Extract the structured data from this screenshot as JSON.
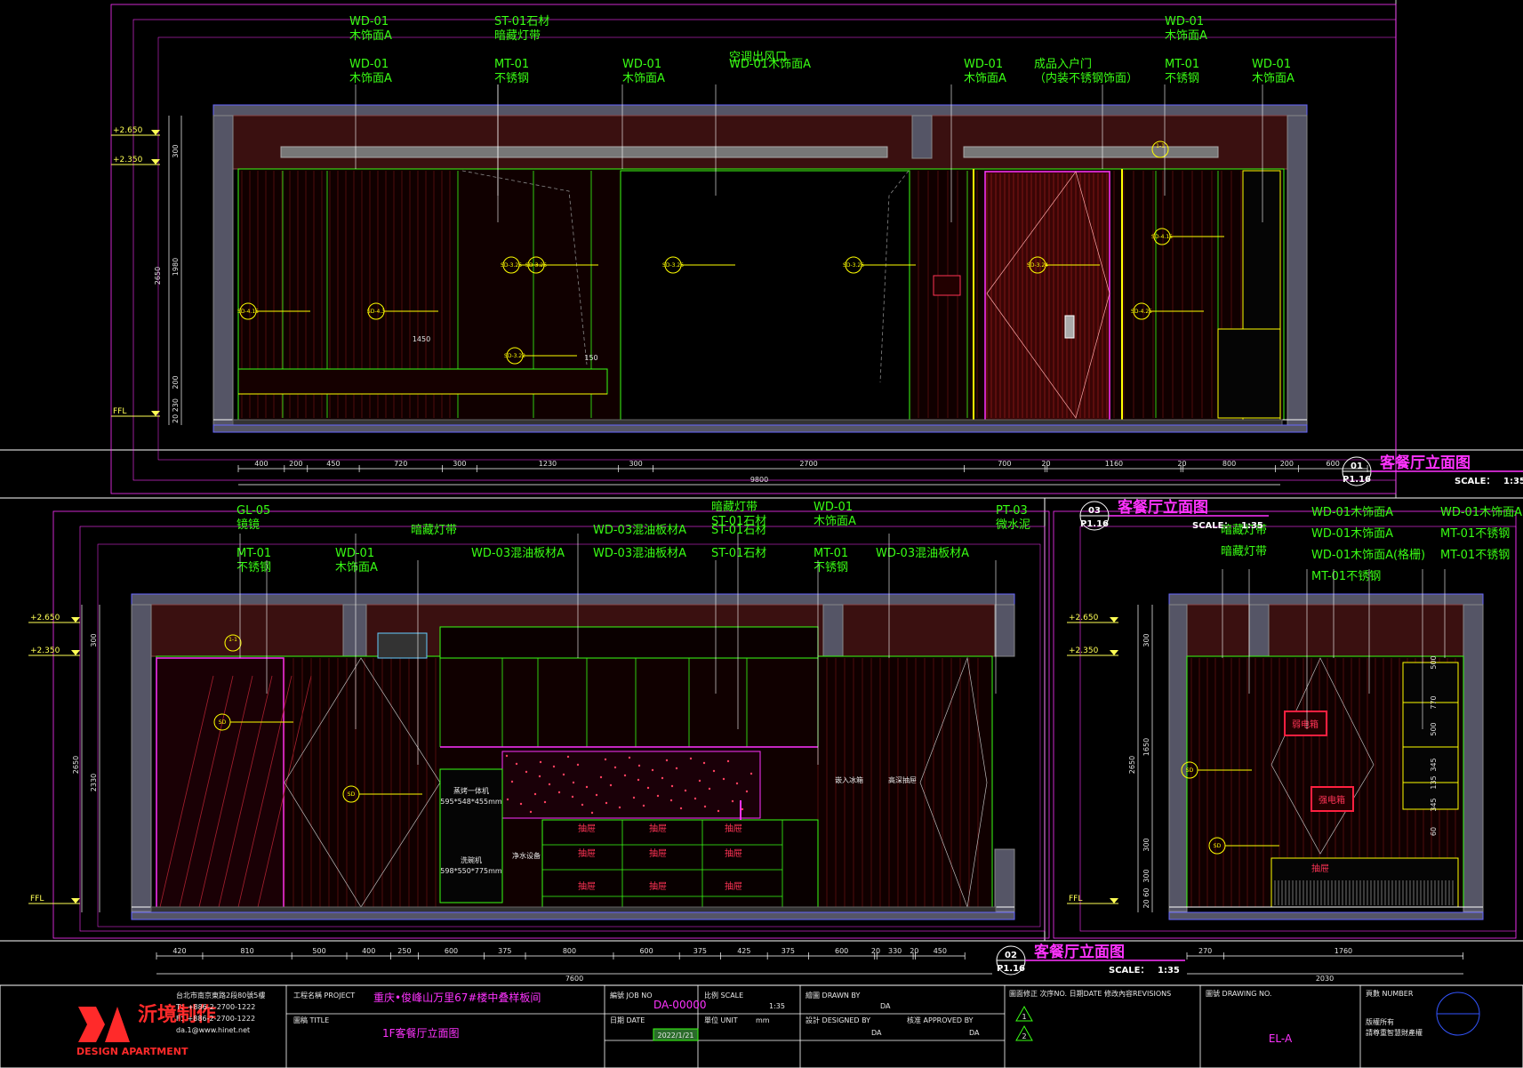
{
  "colors": {
    "bg": "#000000",
    "frame": "#ff33ff",
    "green": "#39ff14",
    "wall": "#555566",
    "ceiling": "#3a1010",
    "dim": "#ffffff",
    "leader": "#ffffff",
    "red": "#cc1030"
  },
  "elev1": {
    "labels": [
      {
        "code": "WD-01",
        "name": "木饰面A"
      },
      {
        "code": "ST-01石材",
        "name": "暗藏灯带"
      },
      {
        "code": "",
        "name": "空调出风口"
      },
      {
        "code": "WD-01",
        "name": "木饰面A"
      },
      {
        "code": "WD-01",
        "name": "木饰面A"
      },
      {
        "code": "MT-01",
        "name": "不锈钢"
      },
      {
        "code": "WD-01",
        "name": "木饰面A"
      },
      {
        "code": "WD-01木饰面A",
        "name": ""
      },
      {
        "code": "WD-01",
        "name": "木饰面A"
      },
      {
        "code": "成品入户门",
        "name": "（内装不锈钢饰面）"
      },
      {
        "code": "MT-01",
        "name": "不锈钢"
      },
      {
        "code": "WD-01",
        "name": "木饰面A"
      }
    ],
    "levels": [
      "+2.650",
      "+2.350",
      "FFL"
    ],
    "vdims": [
      "300",
      "1980",
      "2650",
      "200",
      "20 230"
    ],
    "hdims": [
      "400",
      "200",
      "450",
      "720",
      "300",
      "1230",
      "300",
      "2700",
      "700",
      "20",
      "1160",
      "20",
      "800",
      "200",
      "600"
    ],
    "total": "9800",
    "inner": [
      "1450",
      "150"
    ],
    "title": "客餐厅立面图",
    "num": "01",
    "sheet": "P1.16",
    "scale_label": "SCALE：",
    "scale": "1:35",
    "tags": [
      "SD-4.15",
      "SD-4.3",
      "SD-3.26",
      "SD-3.26",
      "SD-3.26",
      "SD-3.26",
      "SD-3.22",
      "SD-3.24",
      "SD-4.15",
      "SD-4.25"
    ],
    "callout": "1-1"
  },
  "elev2": {
    "labels": [
      {
        "code": "GL-05",
        "name": "镜镜"
      },
      {
        "code": "MT-01",
        "name": "不锈钢"
      },
      {
        "code": "WD-01",
        "name": "木饰面A"
      },
      {
        "code": "暗藏灯带",
        "name": ""
      },
      {
        "code": "WD-03混油板材A",
        "name": ""
      },
      {
        "code": "WD-03混油板材A",
        "name": ""
      },
      {
        "code": "WD-03混油板材A",
        "name": ""
      },
      {
        "code": "暗藏灯带",
        "name": "ST-01石材"
      },
      {
        "code": "ST-01石材",
        "name": ""
      },
      {
        "code": "WD-01",
        "name": "木饰面A"
      },
      {
        "code": "MT-01",
        "name": "不锈钢"
      },
      {
        "code": "WD-03混油板材A",
        "name": ""
      },
      {
        "code": "PT-03",
        "name": "微水泥"
      }
    ],
    "levels": [
      "+2.650",
      "+2.350",
      "FFL"
    ],
    "vdims": [
      "300",
      "2330",
      "2650"
    ],
    "hdims": [
      "420",
      "810",
      "500",
      "400",
      "250",
      "600",
      "375",
      "800",
      "600",
      "375",
      "425",
      "375",
      "600",
      "20",
      "330",
      "20",
      "450"
    ],
    "total": "7600",
    "appliances": [
      "蒸烤一体机",
      "595*548*455mm",
      "洗碗机",
      "598*550*775mm",
      "净水设备",
      "嵌入冰箱",
      "高深抽屉"
    ],
    "drawers": [
      "抽屉",
      "抽屉",
      "抽屉",
      "抽屉",
      "抽屉",
      "抽屉",
      "抽屉",
      "抽屉",
      "抽屉"
    ],
    "title": "客餐厅立面图",
    "num": "02",
    "sheet": "P1.16",
    "scale_label": "SCALE：",
    "scale": "1:35",
    "callout": "1-1"
  },
  "elev3": {
    "labels": [
      {
        "code": "暗藏灯带",
        "name": ""
      },
      {
        "code": "暗藏灯带",
        "name": ""
      },
      {
        "code": "WD-01木饰面A",
        "name": ""
      },
      {
        "code": "WD-01木饰面A",
        "name": ""
      },
      {
        "code": "WD-01木饰面A(格栅)",
        "name": ""
      },
      {
        "code": "MT-01不锈钢",
        "name": ""
      },
      {
        "code": "WD-01木饰面A",
        "name": ""
      },
      {
        "code": "MT-01不锈钢",
        "name": ""
      },
      {
        "code": "MT-01不锈钢",
        "name": ""
      }
    ],
    "levels": [
      "+2.650",
      "+2.350",
      "FFL"
    ],
    "vdims": [
      "300",
      "1650",
      "2650",
      "300",
      "300",
      "20 60"
    ],
    "rdims": [
      "500",
      "770",
      "500",
      "345",
      "135",
      "345",
      "60"
    ],
    "hdims": [
      "270",
      "1760"
    ],
    "inner": [
      "400",
      "400",
      "400",
      "60",
      "60",
      "60"
    ],
    "total": "2030",
    "items": [
      "弱电箱",
      "强电箱",
      "抽屉"
    ],
    "title": "客餐厅立面图",
    "num": "03",
    "sheet": "P1.16",
    "scale_label": "SCALE：",
    "scale": "1:35"
  },
  "titleblock": {
    "company_cn": "沂境制作",
    "company_en": "DESIGN APARTMENT",
    "contact": [
      "台北市南京東路2段80號5樓",
      "T：+886-2-2700-1222",
      "F：+886-2-2700-1222",
      "da.1@www.hinet.net"
    ],
    "project_label": "工程名稱 PROJECT",
    "project": "重庆•俊峰山万里67#楼中叠样板间",
    "title_label": "圖稿 TITLE",
    "title": "1F客餐厅立面图",
    "job_label": "編號 JOB NO",
    "job": "DA-00000",
    "date_label": "日期 DATE",
    "date": "2022/1/21",
    "scale_label": "比例 SCALE",
    "scale": "1:35",
    "unit_label": "單位 UNIT",
    "unit": "mm",
    "drawn_label": "繪圖 DRAWN BY",
    "drawn": "DA",
    "designed_label": "設計 DESIGNED BY",
    "designed": "DA",
    "approved_label": "核准 APPROVED BY",
    "approved": "DA",
    "rev_label": "圖面修正 次序NO. 日期DATE 修改內容REVISIONS",
    "drawing_no_label": "圖號 DRAWING NO.",
    "drawing_no": "EL-A",
    "page_label": "頁數 NUMBER",
    "copyright": [
      "版權所有",
      "請尊重智慧財產權"
    ],
    "rev_marks": [
      "1",
      "2"
    ]
  }
}
